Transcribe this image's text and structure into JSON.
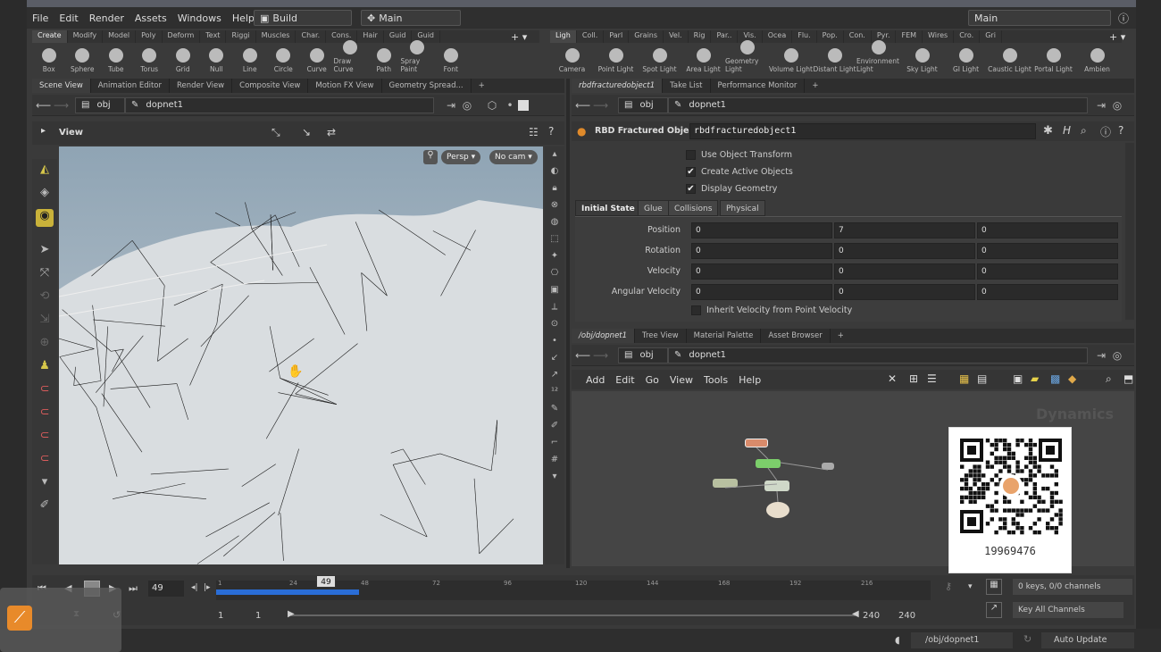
{
  "menubar": {
    "items": [
      "File",
      "Edit",
      "Render",
      "Assets",
      "Windows",
      "Help"
    ],
    "desktop_build": "Build",
    "desktop_main": "Main",
    "right_main": "Main"
  },
  "shelf_left": {
    "tabs": [
      "Create",
      "Modify",
      "Model",
      "Poly",
      "Deform",
      "Text",
      "Riggi",
      "Muscles",
      "Char.",
      "Cons.",
      "Hair",
      "Guid",
      "Guid"
    ],
    "tools": [
      "Box",
      "Sphere",
      "Tube",
      "Torus",
      "Grid",
      "Null",
      "Line",
      "Circle",
      "Curve",
      "Draw Curve",
      "Path",
      "Spray Paint",
      "Font"
    ]
  },
  "shelf_right": {
    "tabs": [
      "Ligh",
      "Coll.",
      "Parl",
      "Grains",
      "Vel.",
      "Rig",
      "Par..",
      "Vis.",
      "Ocea",
      "Flu.",
      "Pop.",
      "Con.",
      "Pyr.",
      "FEM",
      "Wires",
      "Cro.",
      "Gri"
    ],
    "tools": [
      "Camera",
      "Point Light",
      "Spot Light",
      "Area Light",
      "Geometry Light",
      "Volume Light",
      "Distant Light",
      "Environment Light",
      "Sky Light",
      "GI Light",
      "Caustic Light",
      "Portal Light",
      "Ambien"
    ]
  },
  "left_pane": {
    "tabs": [
      "Scene View",
      "Animation Editor",
      "Render View",
      "Composite View",
      "Motion FX View",
      "Geometry Spread..."
    ],
    "path_obj": "obj",
    "path_node": "dopnet1",
    "view_title": "View",
    "persp": "Persp",
    "cam": "No cam"
  },
  "param_pane": {
    "tabs": [
      "rbdfracturedobject1",
      "Take List",
      "Performance Monitor"
    ],
    "path_obj": "obj",
    "path_node": "dopnet1",
    "node_type": "RBD Fractured Object",
    "node_name": "rbdfracturedobject1",
    "checkboxes": [
      {
        "label": "Use Object Transform",
        "checked": false
      },
      {
        "label": "Create Active Objects",
        "checked": true
      },
      {
        "label": "Display Geometry",
        "checked": true
      }
    ],
    "subtabs": [
      "Initial State",
      "Glue",
      "Collisions",
      "Physical"
    ],
    "rows": [
      {
        "label": "Position",
        "values": [
          "0",
          "7",
          "0"
        ]
      },
      {
        "label": "Rotation",
        "values": [
          "0",
          "0",
          "0"
        ]
      },
      {
        "label": "Velocity",
        "values": [
          "0",
          "0",
          "0"
        ]
      },
      {
        "label": "Angular Velocity",
        "values": [
          "0",
          "0",
          "0"
        ]
      }
    ],
    "inherit_label": "Inherit Velocity from Point Velocity"
  },
  "network_pane": {
    "tabs": [
      "/obj/dopnet1",
      "Tree View",
      "Material Palette",
      "Asset Browser"
    ],
    "path_obj": "obj",
    "path_node": "dopnet1",
    "menu": [
      "Add",
      "Edit",
      "Go",
      "View",
      "Tools",
      "Help"
    ],
    "context_label": "Dynamics",
    "qr_id": "19969476"
  },
  "timeline": {
    "frame": "49",
    "marker": "49",
    "ticks": [
      "1",
      "24",
      "48",
      "72",
      "96",
      "120",
      "144",
      "168",
      "192",
      "216"
    ],
    "start": "1",
    "start2": "1",
    "end": "240",
    "end2": "240",
    "progress": 0.2,
    "keys_label": "0 keys, 0/0 channels",
    "key_all": "Key All Channels"
  },
  "status": {
    "path": "/obj/dopnet1",
    "update": "Auto Update"
  },
  "colors": {
    "accent": "#2a6dd6",
    "panel": "#3a3a3a",
    "field": "#2a2a2a"
  }
}
